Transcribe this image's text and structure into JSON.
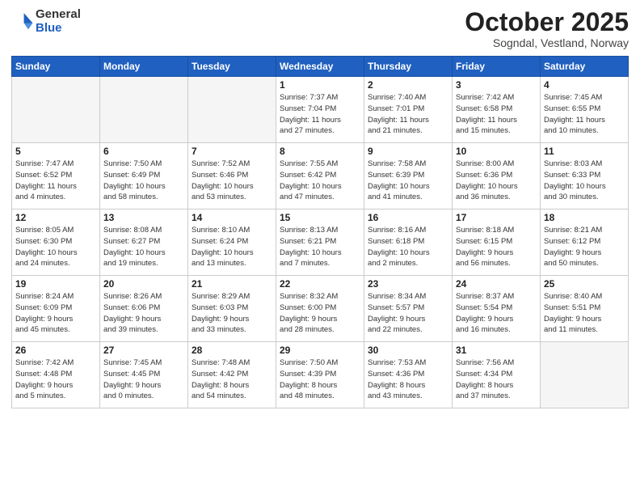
{
  "logo": {
    "general": "General",
    "blue": "Blue"
  },
  "header": {
    "month": "October 2025",
    "location": "Sogndal, Vestland, Norway"
  },
  "weekdays": [
    "Sunday",
    "Monday",
    "Tuesday",
    "Wednesday",
    "Thursday",
    "Friday",
    "Saturday"
  ],
  "weeks": [
    [
      {
        "day": "",
        "info": "",
        "empty": true
      },
      {
        "day": "",
        "info": "",
        "empty": true
      },
      {
        "day": "",
        "info": "",
        "empty": true
      },
      {
        "day": "1",
        "info": "Sunrise: 7:37 AM\nSunset: 7:04 PM\nDaylight: 11 hours\nand 27 minutes."
      },
      {
        "day": "2",
        "info": "Sunrise: 7:40 AM\nSunset: 7:01 PM\nDaylight: 11 hours\nand 21 minutes."
      },
      {
        "day": "3",
        "info": "Sunrise: 7:42 AM\nSunset: 6:58 PM\nDaylight: 11 hours\nand 15 minutes."
      },
      {
        "day": "4",
        "info": "Sunrise: 7:45 AM\nSunset: 6:55 PM\nDaylight: 11 hours\nand 10 minutes."
      }
    ],
    [
      {
        "day": "5",
        "info": "Sunrise: 7:47 AM\nSunset: 6:52 PM\nDaylight: 11 hours\nand 4 minutes."
      },
      {
        "day": "6",
        "info": "Sunrise: 7:50 AM\nSunset: 6:49 PM\nDaylight: 10 hours\nand 58 minutes."
      },
      {
        "day": "7",
        "info": "Sunrise: 7:52 AM\nSunset: 6:46 PM\nDaylight: 10 hours\nand 53 minutes."
      },
      {
        "day": "8",
        "info": "Sunrise: 7:55 AM\nSunset: 6:42 PM\nDaylight: 10 hours\nand 47 minutes."
      },
      {
        "day": "9",
        "info": "Sunrise: 7:58 AM\nSunset: 6:39 PM\nDaylight: 10 hours\nand 41 minutes."
      },
      {
        "day": "10",
        "info": "Sunrise: 8:00 AM\nSunset: 6:36 PM\nDaylight: 10 hours\nand 36 minutes."
      },
      {
        "day": "11",
        "info": "Sunrise: 8:03 AM\nSunset: 6:33 PM\nDaylight: 10 hours\nand 30 minutes."
      }
    ],
    [
      {
        "day": "12",
        "info": "Sunrise: 8:05 AM\nSunset: 6:30 PM\nDaylight: 10 hours\nand 24 minutes."
      },
      {
        "day": "13",
        "info": "Sunrise: 8:08 AM\nSunset: 6:27 PM\nDaylight: 10 hours\nand 19 minutes."
      },
      {
        "day": "14",
        "info": "Sunrise: 8:10 AM\nSunset: 6:24 PM\nDaylight: 10 hours\nand 13 minutes."
      },
      {
        "day": "15",
        "info": "Sunrise: 8:13 AM\nSunset: 6:21 PM\nDaylight: 10 hours\nand 7 minutes."
      },
      {
        "day": "16",
        "info": "Sunrise: 8:16 AM\nSunset: 6:18 PM\nDaylight: 10 hours\nand 2 minutes."
      },
      {
        "day": "17",
        "info": "Sunrise: 8:18 AM\nSunset: 6:15 PM\nDaylight: 9 hours\nand 56 minutes."
      },
      {
        "day": "18",
        "info": "Sunrise: 8:21 AM\nSunset: 6:12 PM\nDaylight: 9 hours\nand 50 minutes."
      }
    ],
    [
      {
        "day": "19",
        "info": "Sunrise: 8:24 AM\nSunset: 6:09 PM\nDaylight: 9 hours\nand 45 minutes."
      },
      {
        "day": "20",
        "info": "Sunrise: 8:26 AM\nSunset: 6:06 PM\nDaylight: 9 hours\nand 39 minutes."
      },
      {
        "day": "21",
        "info": "Sunrise: 8:29 AM\nSunset: 6:03 PM\nDaylight: 9 hours\nand 33 minutes."
      },
      {
        "day": "22",
        "info": "Sunrise: 8:32 AM\nSunset: 6:00 PM\nDaylight: 9 hours\nand 28 minutes."
      },
      {
        "day": "23",
        "info": "Sunrise: 8:34 AM\nSunset: 5:57 PM\nDaylight: 9 hours\nand 22 minutes."
      },
      {
        "day": "24",
        "info": "Sunrise: 8:37 AM\nSunset: 5:54 PM\nDaylight: 9 hours\nand 16 minutes."
      },
      {
        "day": "25",
        "info": "Sunrise: 8:40 AM\nSunset: 5:51 PM\nDaylight: 9 hours\nand 11 minutes."
      }
    ],
    [
      {
        "day": "26",
        "info": "Sunrise: 7:42 AM\nSunset: 4:48 PM\nDaylight: 9 hours\nand 5 minutes."
      },
      {
        "day": "27",
        "info": "Sunrise: 7:45 AM\nSunset: 4:45 PM\nDaylight: 9 hours\nand 0 minutes."
      },
      {
        "day": "28",
        "info": "Sunrise: 7:48 AM\nSunset: 4:42 PM\nDaylight: 8 hours\nand 54 minutes."
      },
      {
        "day": "29",
        "info": "Sunrise: 7:50 AM\nSunset: 4:39 PM\nDaylight: 8 hours\nand 48 minutes."
      },
      {
        "day": "30",
        "info": "Sunrise: 7:53 AM\nSunset: 4:36 PM\nDaylight: 8 hours\nand 43 minutes."
      },
      {
        "day": "31",
        "info": "Sunrise: 7:56 AM\nSunset: 4:34 PM\nDaylight: 8 hours\nand 37 minutes."
      },
      {
        "day": "",
        "info": "",
        "empty": true
      }
    ]
  ]
}
